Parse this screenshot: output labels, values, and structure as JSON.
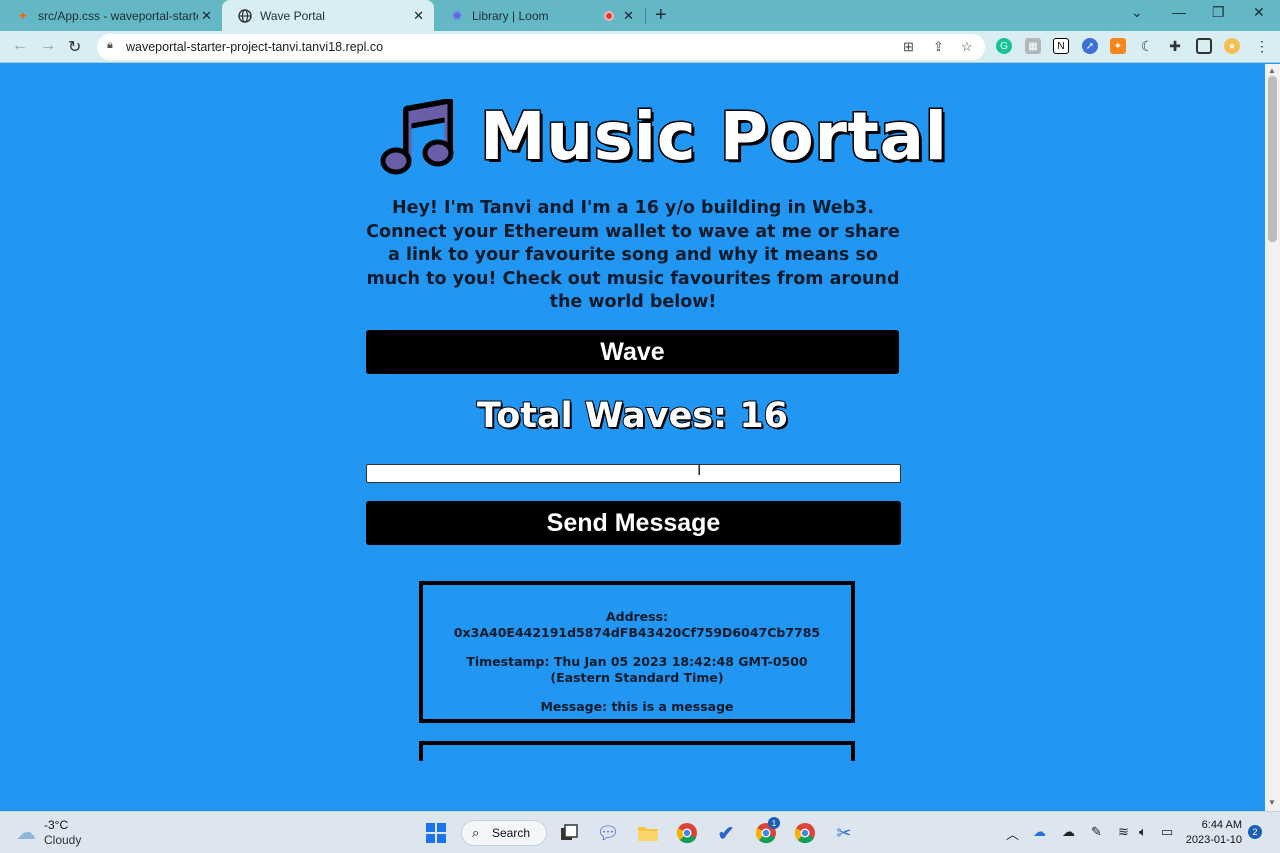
{
  "browser": {
    "tabs": [
      {
        "title": "src/App.css - waveportal-starter-",
        "favicon": "replit-icon"
      },
      {
        "title": "Wave Portal",
        "favicon": "globe-icon"
      },
      {
        "title": "Library | Loom",
        "favicon": "loom-icon"
      }
    ],
    "url": "waveportal-starter-project-tanvi.tanvi18.repl.co"
  },
  "page": {
    "title": "Music Portal",
    "intro": "Hey! I'm Tanvi and I'm a 16 y/o building in Web3. Connect your Ethereum wallet to wave at me or share a link to your favourite song and why it means so much to you! Check out music favourites from around the world below!",
    "wave_button": "Wave",
    "total_waves": "Total Waves: 16",
    "message_input_value": "",
    "send_button": "Send Message",
    "waves": [
      {
        "address": "Address: 0x3A40E442191d5874dFB43420Cf759D6047Cb7785",
        "timestamp": "Timestamp: Thu Jan 05 2023 18:42:48 GMT-0500 (Eastern Standard Time)",
        "message": "Message: this is a message"
      }
    ]
  },
  "taskbar": {
    "weather_temp": "-3°C",
    "weather_desc": "Cloudy",
    "search_label": "Search",
    "time": "6:44 AM",
    "date": "2023-01-10",
    "notifications": "2",
    "chrome_badge": "1"
  },
  "colors": {
    "page_bg": "#2196f3",
    "button_bg": "#000000",
    "tab_strip": "#64b8c6"
  }
}
